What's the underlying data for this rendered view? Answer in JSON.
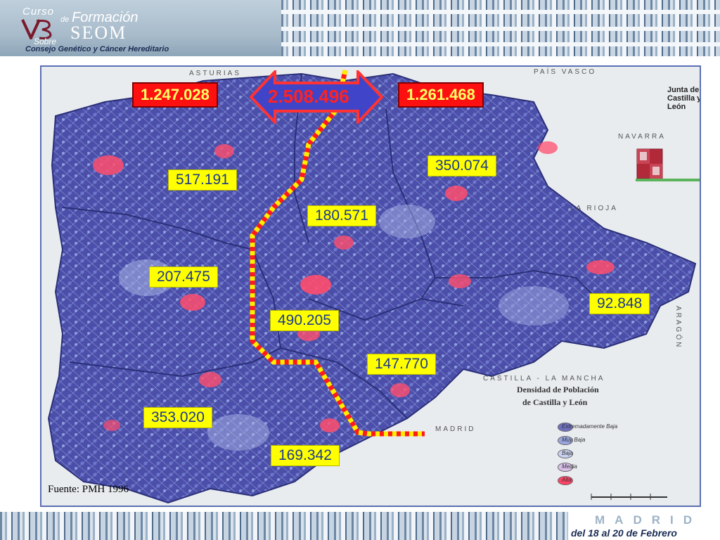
{
  "header": {
    "logo_curso": "Curso",
    "logo_de": "de",
    "logo_formacion": "Formación",
    "logo_seom": "SEOM",
    "logo_sobre": "Sobre",
    "logo_subtitle": "Consejo Genético y Cáncer Hereditario"
  },
  "map": {
    "title_line1": "Densidad de Población",
    "title_line2": "de Castilla y León",
    "source": "Fuente: PMH 1996",
    "total": "2.508.496",
    "west_total": "1.247.028",
    "east_total": "1.261.468",
    "provinces": [
      {
        "label": "517.191"
      },
      {
        "label": "180.571"
      },
      {
        "label": "350.074"
      },
      {
        "label": "207.475"
      },
      {
        "label": "490.205"
      },
      {
        "label": "92.848"
      },
      {
        "label": "147.770"
      },
      {
        "label": "353.020"
      },
      {
        "label": "169.342"
      }
    ],
    "neighbors": {
      "north": "ASTURIAS",
      "pais_vasco": "PAÍS VASCO",
      "navarra": "NAVARRA",
      "rioja": "LA RIOJA",
      "aragon": "ARAGÓN",
      "castilla_mancha": "CASTILLA - LA MANCHA",
      "madrid": "MADRID"
    },
    "legend": [
      {
        "label": "Extremadamente Baja",
        "color": "#6f6fc0"
      },
      {
        "label": "Muy Baja",
        "color": "#9aa6e0"
      },
      {
        "label": "Baja",
        "color": "#c9d2f2"
      },
      {
        "label": "Media",
        "color": "#d8c0e8"
      },
      {
        "label": "Alta",
        "color": "#ff4466"
      }
    ],
    "emblem_text": "Junta de Castilla y León",
    "colors": {
      "region": "#4a4fa8",
      "dense": "#ff4d6d",
      "border_line": "#ff1a1a",
      "border_dash": "#ffee00"
    }
  },
  "footer": {
    "city": "MADRID",
    "dates": "del 18 al 20 de Febrero"
  }
}
